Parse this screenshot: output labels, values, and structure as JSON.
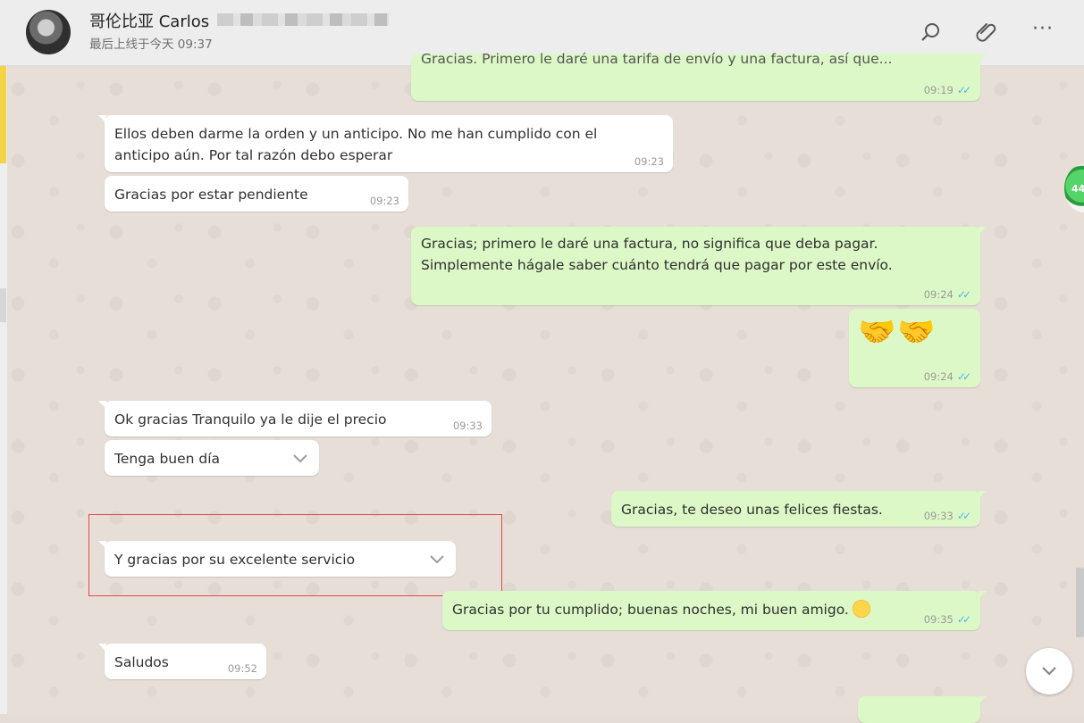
{
  "header": {
    "contact_name": "哥伦比亚 Carlos",
    "last_seen": "最后上线于今天 09:37",
    "icons": {
      "search": "search-icon",
      "attach": "paperclip-icon",
      "menu": "more-menu-icon"
    }
  },
  "colors": {
    "incoming": "#ffffff",
    "outgoing": "#dcf8c6",
    "read_ticks": "#4fb6ec",
    "highlight": "#e04a4a"
  },
  "messages": [
    {
      "text": "Gracias. Primero le daré una tarifa de envío y una factura, así que...",
      "time": "09:19",
      "direction": "out"
    },
    {
      "text": "Ellos deben darme la orden y un anticipo. No me han cumplido con el\nanticipo aún. Por tal razón  debo esperar",
      "time": "09:23",
      "direction": "in"
    },
    {
      "text": "Gracias por estar pendiente",
      "time": "09:23",
      "direction": "in"
    },
    {
      "text": "Gracias; primero le daré una factura, no significa que deba pagar.\nSimplemente hágale saber cuánto tendrá que pagar por este envío.",
      "time": "09:24",
      "direction": "out"
    },
    {
      "text": "🤝🤝",
      "time": "09:24",
      "direction": "out"
    },
    {
      "text": "Ok gracias  Tranquilo ya le dije el precio",
      "time": "09:33",
      "direction": "in"
    },
    {
      "text": "Tenga buen día",
      "time": "",
      "direction": "in"
    },
    {
      "text": "Gracias, te deseo unas felices fiestas.",
      "time": "09:33",
      "direction": "out"
    },
    {
      "text": "Y  gracias por su excelente servicio",
      "time": "",
      "direction": "in"
    },
    {
      "text": "Gracias por tu cumplido; buenas noches, mi buen amigo.",
      "time": "09:35",
      "direction": "out"
    },
    {
      "text": "Saludos",
      "time": "09:52",
      "direction": "in"
    }
  ],
  "read_ticks": "✓✓",
  "unread_badge": "44",
  "scroll_down_icon": "chevron-down-icon"
}
